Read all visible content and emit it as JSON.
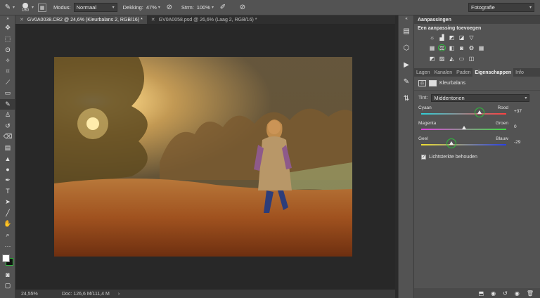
{
  "options_bar": {
    "brush_size": "160",
    "mode_label": "Modus:",
    "mode_value": "Normaal",
    "opacity_label": "Dekking:",
    "opacity_value": "47%",
    "flow_label": "Strm:",
    "flow_value": "100%",
    "workspace": "Fotografie"
  },
  "tabs": [
    {
      "label": "GV0A0038.CR2 @ 24,6% (Kleurbalans 2, RGB/16) *",
      "active": true
    },
    {
      "label": "GV0A0058.psd @ 26,6% (Laag 2, RGB/16) *",
      "active": false
    }
  ],
  "status_bar": {
    "zoom": "24,55%",
    "doc": "Doc: 126,6 M/111,4 M"
  },
  "adjustments_panel": {
    "title": "Aanpassingen",
    "subtitle": "Een aanpassing toevoegen"
  },
  "properties_tabs": [
    "Lagen",
    "Kanalen",
    "Paden",
    "Eigenschappen",
    "Info"
  ],
  "properties": {
    "title": "Kleurbalans",
    "tone_label": "Tint:",
    "tone_value": "Middentonen",
    "sliders": [
      {
        "left": "Cyaan",
        "right": "Rood",
        "value": "+37",
        "level": 37
      },
      {
        "left": "Magenta",
        "right": "Groen",
        "value": "0",
        "level": 0
      },
      {
        "left": "Geel",
        "right": "Blauw",
        "value": "-29",
        "level": -29
      }
    ],
    "preserve_luminosity": "Lichtsterkte behouden"
  },
  "colors": {
    "highlight_ring": "#2dbf3b",
    "panel_bg": "#535353"
  }
}
